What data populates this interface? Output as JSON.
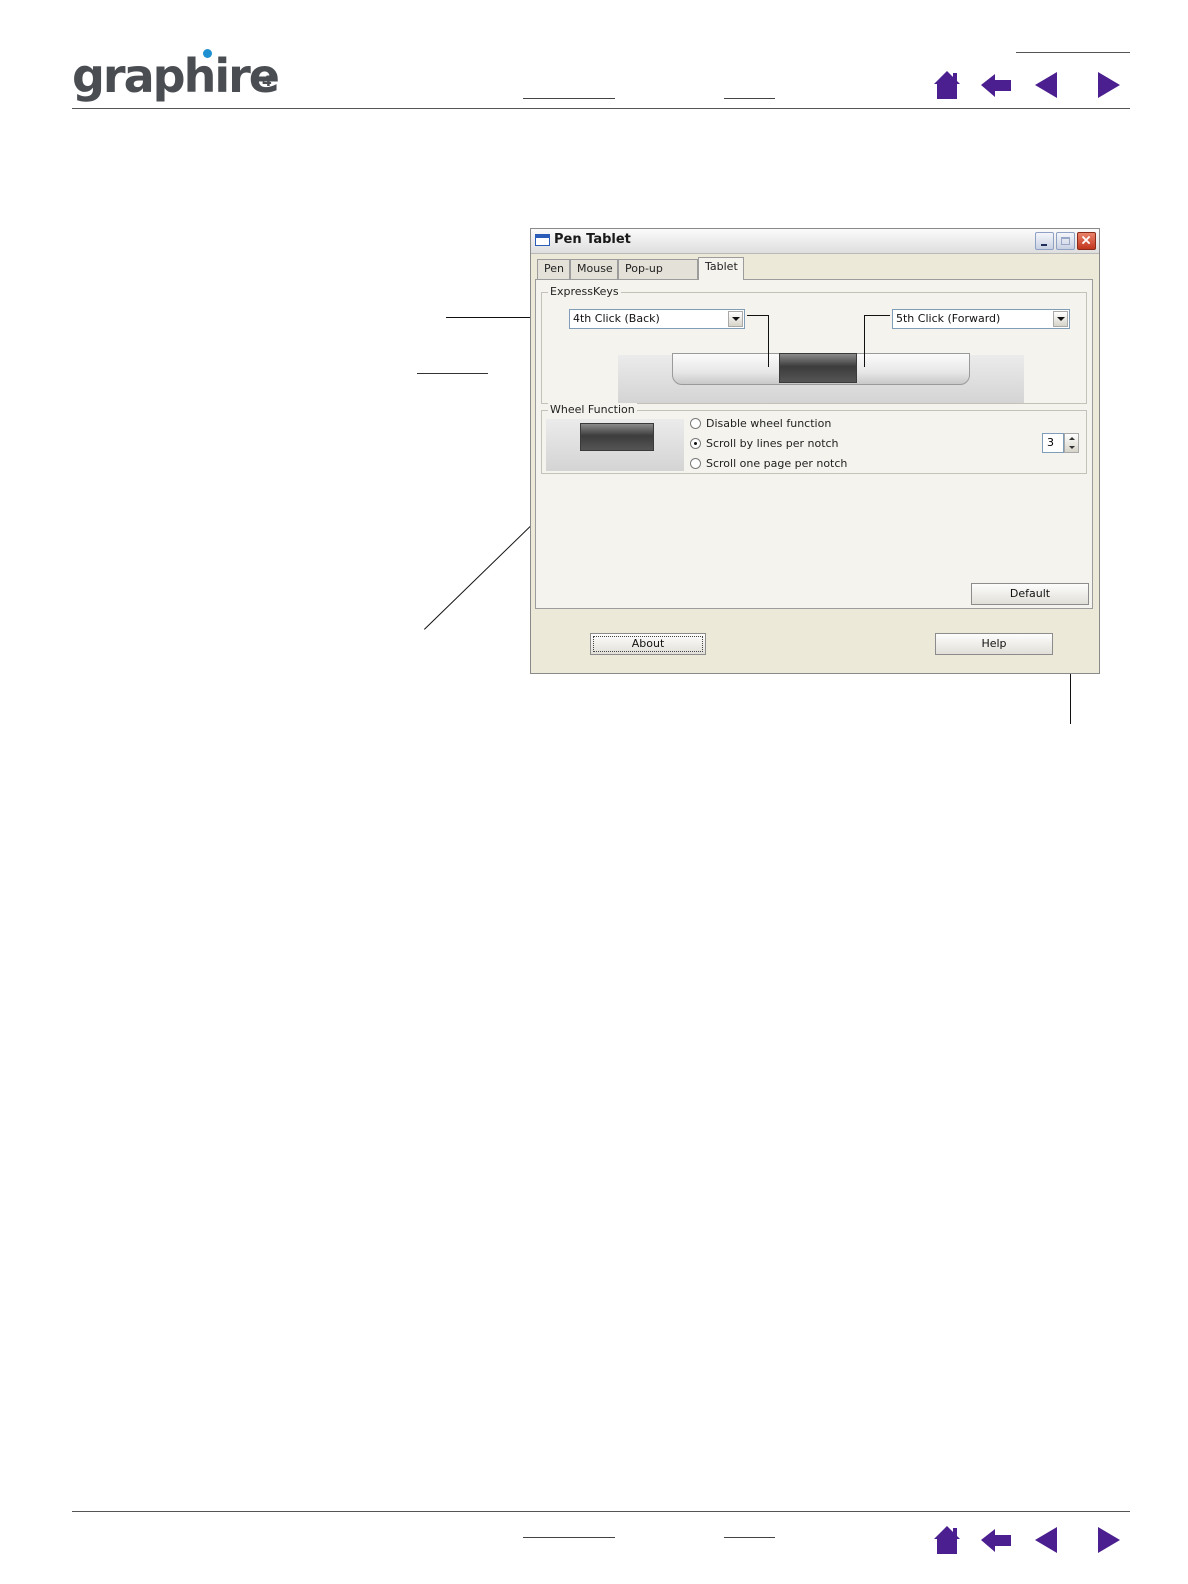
{
  "header": {
    "logo_text": "graphire",
    "logo_sub": "4",
    "colors": {
      "logo_gray": "#4a4d52",
      "logo_dot": "#1e8fd0",
      "nav_purple": "#4b1f8f"
    }
  },
  "nav": {
    "home_icon": "home-icon",
    "back_icon": "back-arrow-icon",
    "prev_icon": "previous-page-icon",
    "next_icon": "next-page-icon"
  },
  "dialog": {
    "title": "Pen Tablet",
    "tabs": [
      {
        "label": "Pen"
      },
      {
        "label": "Mouse"
      },
      {
        "label": "Pop-up Menu"
      },
      {
        "label": "Tablet"
      }
    ],
    "active_tab": "Tablet",
    "express_keys": {
      "group_label": "ExpressKeys",
      "left_value": "4th Click (Back)",
      "right_value": "5th Click (Forward)"
    },
    "wheel_function": {
      "group_label": "Wheel Function",
      "options": [
        {
          "label": "Disable wheel function",
          "selected": false
        },
        {
          "label": "Scroll by lines per notch",
          "selected": true
        },
        {
          "label": "Scroll one page per notch",
          "selected": false
        }
      ],
      "lines_value": "3"
    },
    "default_button": "Default",
    "about_button": "About",
    "help_button": "Help"
  }
}
